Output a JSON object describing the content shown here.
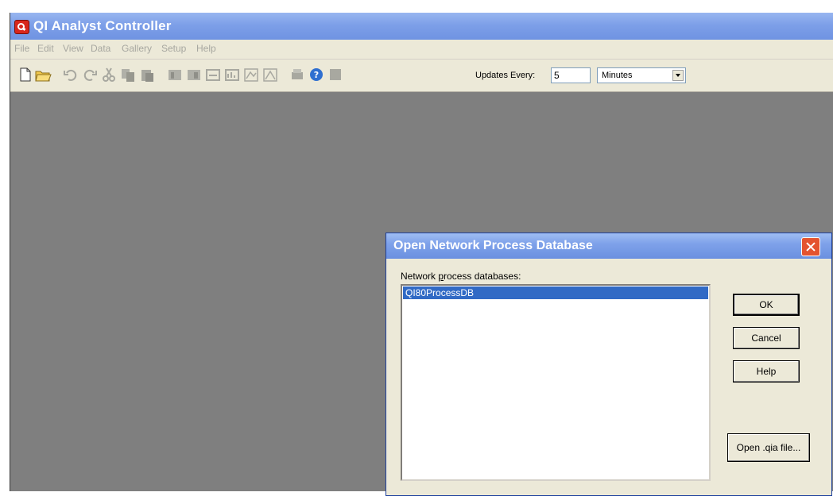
{
  "window": {
    "title": "QI Analyst Controller"
  },
  "menu": [
    "File",
    "Edit",
    "View",
    "Data",
    "Gallery",
    "Setup",
    "Help"
  ],
  "toolbar": {
    "updates_label": "Updates Every:",
    "updates_value": "5",
    "unit_value": "Minutes"
  },
  "dialog": {
    "title": "Open Network Process Database",
    "list_label_pre": "Network ",
    "list_label_accel": "p",
    "list_label_post": "rocess databases:",
    "items": [
      "QI80ProcessDB"
    ],
    "buttons": {
      "ok": "OK",
      "cancel": "Cancel",
      "help": "Help",
      "open_qia": "Open .qia file..."
    }
  }
}
